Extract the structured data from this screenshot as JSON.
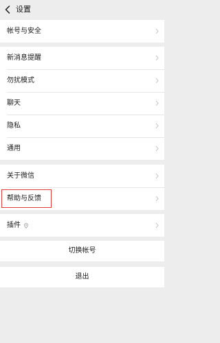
{
  "header": {
    "title": "设置",
    "back_icon": "chevron-left-icon"
  },
  "group_account": {
    "items": [
      {
        "label": "帐号与安全"
      }
    ]
  },
  "group_general": {
    "items": [
      {
        "label": "新消息提醒"
      },
      {
        "label": "勿扰模式"
      },
      {
        "label": "聊天"
      },
      {
        "label": "隐私"
      },
      {
        "label": "通用"
      }
    ]
  },
  "group_about": {
    "items": [
      {
        "label": "关于微信"
      },
      {
        "label": "帮助与反馈"
      }
    ]
  },
  "group_plugins": {
    "items": [
      {
        "label": "插件",
        "badge_icon": "location-pin-icon"
      }
    ]
  },
  "actions": {
    "switch_account": "切换帐号",
    "logout": "退出"
  },
  "colors": {
    "background": "#ededed",
    "row_background": "#ffffff",
    "highlight": "#e53935",
    "chevron": "#c7c7c7"
  }
}
